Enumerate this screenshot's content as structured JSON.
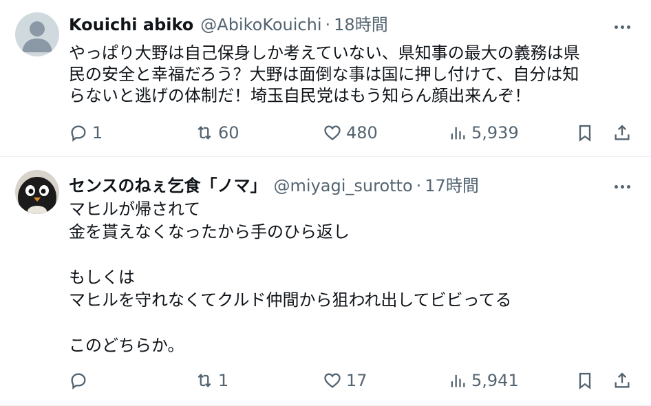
{
  "tweets": [
    {
      "name": "Kouichi abiko",
      "handle": "@AbikoKouichi",
      "dot": "·",
      "time": "18時間",
      "text": "やっぱり大野は自己保身しか考えていない、県知事の最大の義務は県\n民の安全と幸福だろう？大野は面倒な事は国に押し付けて、自分は知\nらないと逃げの体制だ！埼玉自民党はもう知らん顔出来んぞ！",
      "replies": "1",
      "reposts": "60",
      "likes": "480",
      "views": "5,939",
      "avatar": "default-avatar"
    },
    {
      "name": "センスのねぇ乞食「ノマ」",
      "handle": "@miyagi_surotto",
      "dot": "·",
      "time": "17時間",
      "text": "マヒルが帰されて\n金を貰えなくなったから手のひら返し\n\nもしくは\nマヒルを守れなくてクルド仲間から狙われ出してビビってる\n\nこのどちらか。",
      "replies": "",
      "reposts": "1",
      "likes": "17",
      "views": "5,941",
      "avatar": "penguin-avatar"
    }
  ],
  "colors": {
    "text": "#0f1419",
    "secondary": "#536471",
    "divider": "#eff3f4"
  }
}
